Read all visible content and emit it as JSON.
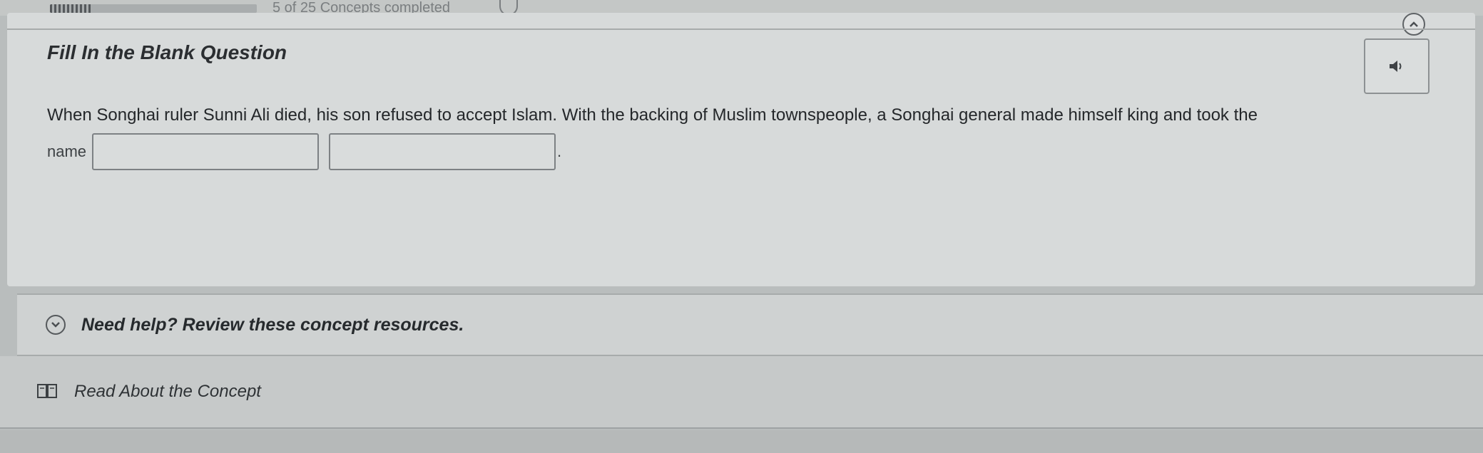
{
  "top_bar": {
    "progress_text": "5 of 25 Concepts completed",
    "progress_fraction": 0.2,
    "info_icon": "info-icon"
  },
  "question": {
    "heading": "Fill In the Blank Question",
    "audio_icon": "speaker-icon",
    "prompt": "When Songhai ruler Sunni Ali died, his son refused to accept Islam. With the backing of Muslim townspeople, a Songhai general made himself king and took the",
    "blank_prefix": "name",
    "blank_1_value": "",
    "blank_2_value": "",
    "blank_suffix": "."
  },
  "help": {
    "toggle_icon": "chevron-down-icon",
    "text": "Need help? Review these concept resources."
  },
  "resources": {
    "read_icon": "book-icon",
    "read_label": "Read About the Concept"
  }
}
